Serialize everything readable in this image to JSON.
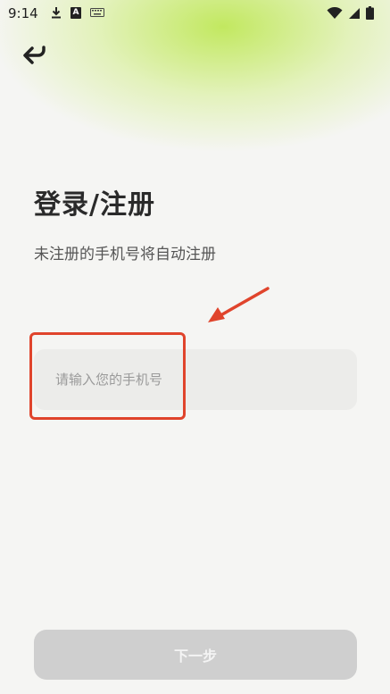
{
  "status_bar": {
    "time": "9:14",
    "left_icons": [
      "download-icon",
      "a-notification-icon",
      "keyboard-icon"
    ],
    "a_label": "A",
    "right_icons": [
      "wifi-icon",
      "signal-icon",
      "battery-icon"
    ]
  },
  "header": {
    "back_icon": "back-arrow-icon"
  },
  "main": {
    "title": "登录/注册",
    "subtitle": "未注册的手机号将自动注册",
    "phone_input": {
      "placeholder": "请输入您的手机号",
      "value": ""
    }
  },
  "annotation": {
    "color": "#e0442c"
  },
  "footer": {
    "next_label": "下一步"
  },
  "colors": {
    "background": "#f5f5f3",
    "accent_glow": "#b9e646",
    "button_disabled": "#cfcfcf"
  }
}
